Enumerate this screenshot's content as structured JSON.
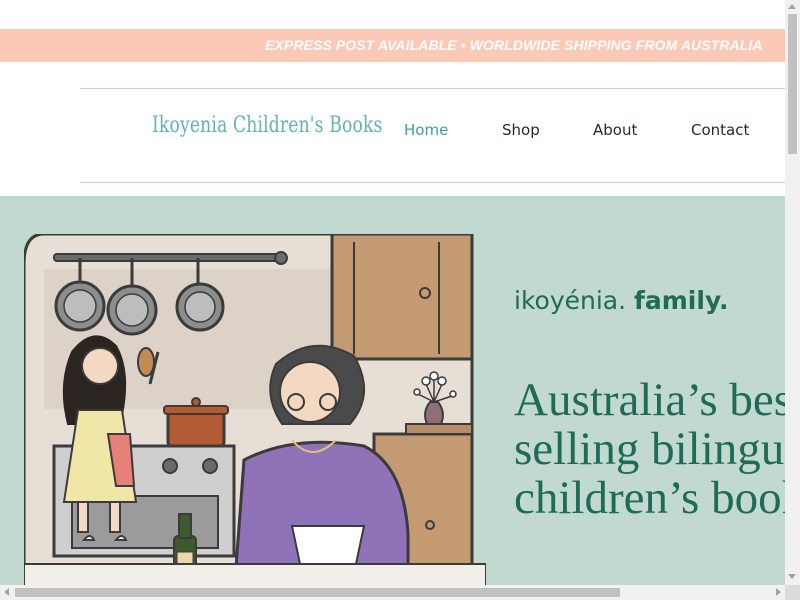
{
  "banner": {
    "text": "EXPRESS POST AVAILABLE • WORLDWIDE SHIPPING FROM AUSTRALIA"
  },
  "header": {
    "logo": "Ikoyenia Children's Books",
    "nav": [
      {
        "label": "Home",
        "active": true
      },
      {
        "label": "Shop",
        "active": false
      },
      {
        "label": "About",
        "active": false
      },
      {
        "label": "Contact",
        "active": false
      }
    ]
  },
  "hero": {
    "tagline_light": "ikoyénia.",
    "tagline_bold": "family.",
    "headline_lines": [
      "Australia’s best",
      "selling bilingual",
      "children’s books"
    ],
    "illustration_icon": "kitchen-illustration"
  },
  "colors": {
    "banner": "#fbc9b5",
    "accent": "#3d9d9b",
    "hero_bg": "#c2d9d0",
    "headline": "#1e6b58"
  }
}
